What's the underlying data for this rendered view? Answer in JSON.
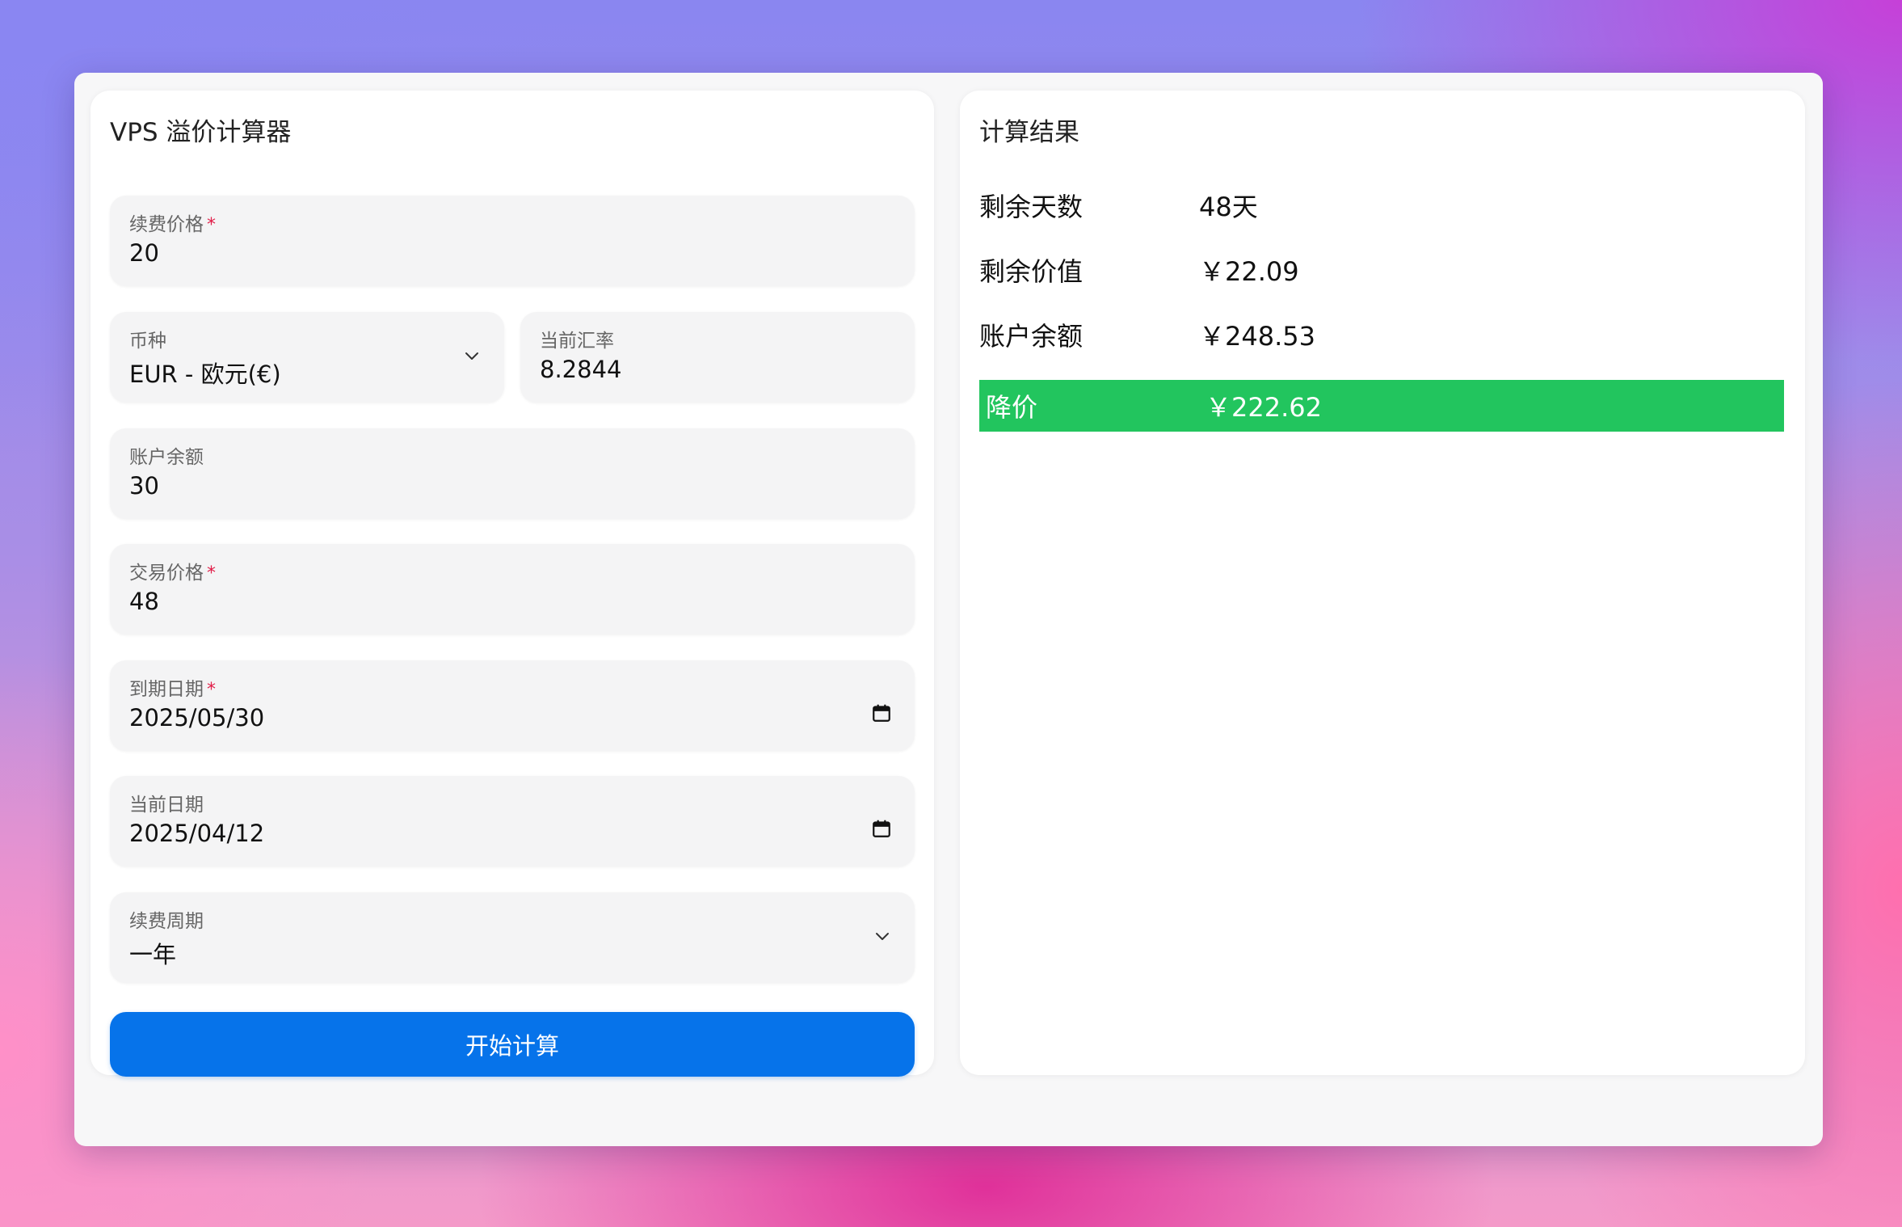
{
  "calculator": {
    "title": "VPS 溢价计算器",
    "fields": {
      "renewal_price": {
        "label": "续费价格",
        "required_mark": "*",
        "value": "20"
      },
      "currency": {
        "label": "币种",
        "value": "EUR - 欧元(€)"
      },
      "exchange_rate": {
        "label": "当前汇率",
        "value": "8.2844"
      },
      "account_balance": {
        "label": "账户余额",
        "value": "30"
      },
      "trade_price": {
        "label": "交易价格",
        "required_mark": "*",
        "value": "48"
      },
      "expiry_date": {
        "label": "到期日期",
        "required_mark": "*",
        "value": "2025/05/30"
      },
      "current_date": {
        "label": "当前日期",
        "value": "2025/04/12"
      },
      "renewal_cycle": {
        "label": "续费周期",
        "value": "一年"
      }
    },
    "submit_label": "开始计算"
  },
  "results": {
    "title": "计算结果",
    "rows": [
      {
        "label": "剩余天数",
        "value": "48天"
      },
      {
        "label": "剩余价值",
        "value": "￥22.09"
      },
      {
        "label": "账户余额",
        "value": "￥248.53"
      }
    ],
    "highlight": {
      "label": "降价",
      "value": "￥222.62"
    }
  },
  "colors": {
    "primary_button": "#0673ea",
    "highlight_green": "#22c55e",
    "required_red": "#e11d48"
  },
  "icons": {
    "dropdown": "chevron-down-icon",
    "date_picker": "calendar-icon"
  }
}
